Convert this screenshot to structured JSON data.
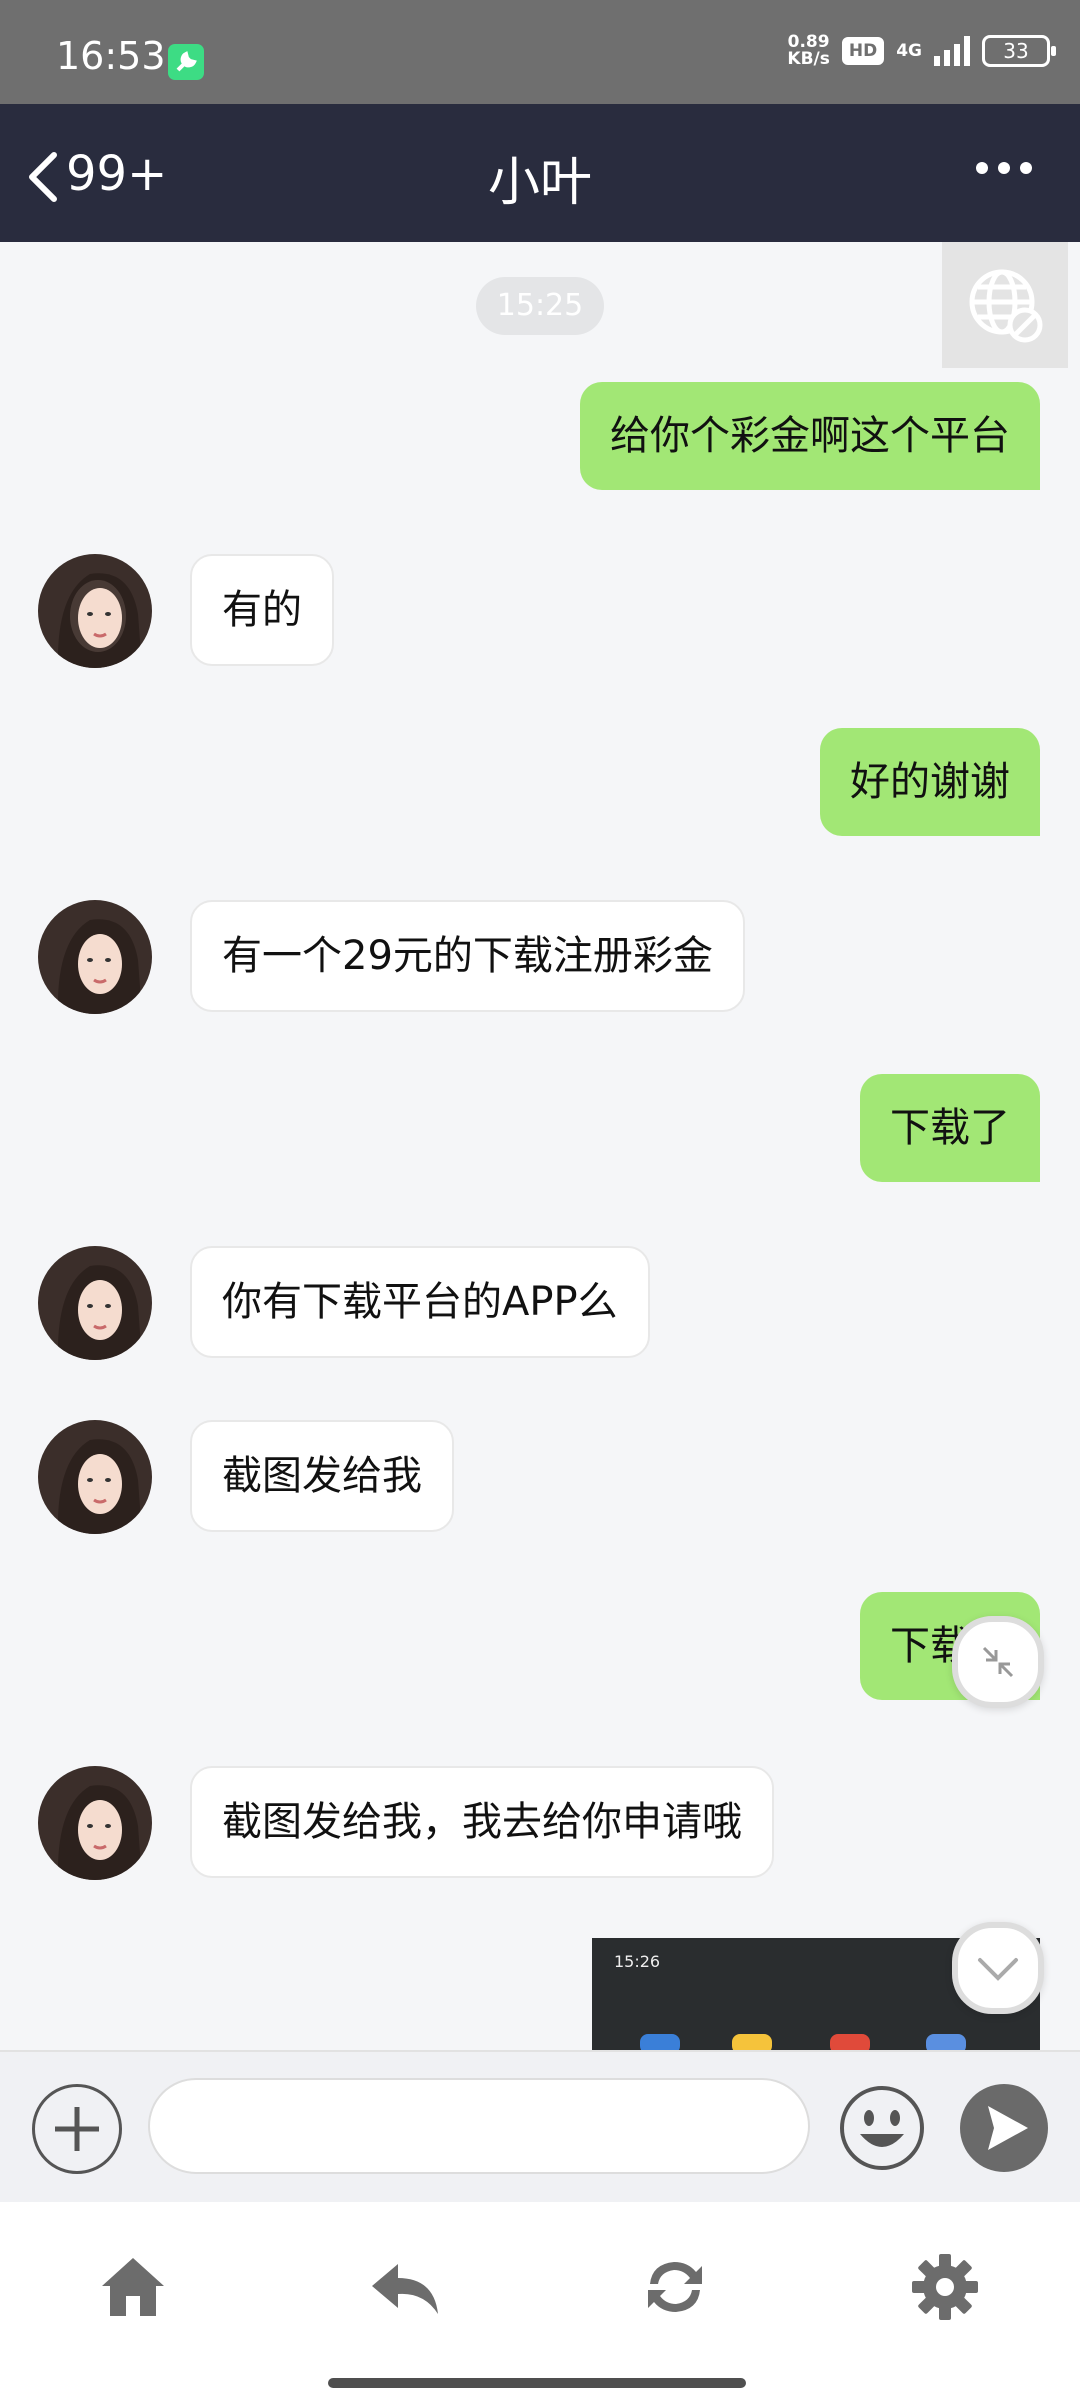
{
  "status_bar": {
    "time": "16:53",
    "speed_value": "0.89",
    "speed_unit": "KB/s",
    "hd": "HD",
    "network": "4G",
    "battery": "33"
  },
  "header": {
    "back_count": "99+",
    "title": "小叶"
  },
  "chat": {
    "time_divider": "15:25",
    "messages": [
      {
        "side": "out",
        "text": "给你个彩金啊这个平台"
      },
      {
        "side": "in",
        "text": "有的"
      },
      {
        "side": "out",
        "text": "好的谢谢"
      },
      {
        "side": "in",
        "text": "有一个29元的下载注册彩金"
      },
      {
        "side": "out",
        "text": "下载了"
      },
      {
        "side": "in",
        "text": "你有下载平台的APP么"
      },
      {
        "side": "in",
        "text": "截图发给我"
      },
      {
        "side": "out",
        "text": "下载了"
      },
      {
        "side": "in",
        "text": "截图发给我，我去给你申请哦"
      }
    ],
    "image_message": {
      "time": "15:26"
    }
  },
  "input": {
    "placeholder": "",
    "value": ""
  },
  "colors": {
    "header_bg": "#292c3e",
    "outgoing_bubble": "#a2e775",
    "incoming_bubble": "#ffffff",
    "chat_bg": "#f5f6f8"
  },
  "icons": {
    "back": "chevron-left-icon",
    "more": "more-dots-icon",
    "translate": "globe-icon",
    "add": "plus-icon",
    "emoji": "smiley-icon",
    "send": "send-icon",
    "nav": [
      "home-icon",
      "reply-icon",
      "refresh-icon",
      "gear-icon"
    ]
  }
}
